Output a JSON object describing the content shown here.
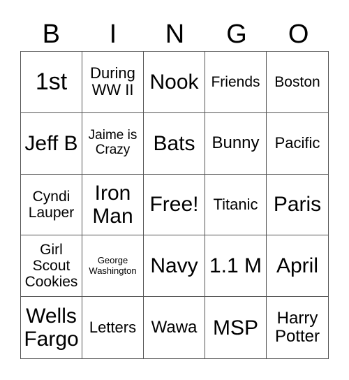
{
  "header": [
    "B",
    "I",
    "N",
    "G",
    "O"
  ],
  "cells": [
    {
      "text": "1st",
      "size": "s36"
    },
    {
      "text": "During WW II",
      "size": "s22"
    },
    {
      "text": "Nook",
      "size": "s30"
    },
    {
      "text": "Friends",
      "size": "s20"
    },
    {
      "text": "Boston",
      "size": "s20"
    },
    {
      "text": "Jeff B",
      "size": "s30"
    },
    {
      "text": "Jaime is Crazy",
      "size": "s18"
    },
    {
      "text": "Bats",
      "size": "s30"
    },
    {
      "text": "Bunny",
      "size": "s24"
    },
    {
      "text": "Pacific",
      "size": "s22"
    },
    {
      "text": "Cyndi Lauper",
      "size": "s20"
    },
    {
      "text": "Iron Man",
      "size": "s30"
    },
    {
      "text": "Free!",
      "size": "s30"
    },
    {
      "text": "Titanic",
      "size": "s22"
    },
    {
      "text": "Paris",
      "size": "s30"
    },
    {
      "text": "Girl Scout Cookies",
      "size": "s20"
    },
    {
      "text": "George Washington",
      "size": "s13"
    },
    {
      "text": "Navy",
      "size": "s30"
    },
    {
      "text": "1.1 M",
      "size": "s30"
    },
    {
      "text": "April",
      "size": "s30"
    },
    {
      "text": "Wells Fargo",
      "size": "s30"
    },
    {
      "text": "Letters",
      "size": "s22"
    },
    {
      "text": "Wawa",
      "size": "s24"
    },
    {
      "text": "MSP",
      "size": "s30"
    },
    {
      "text": "Harry Potter",
      "size": "s24"
    }
  ]
}
